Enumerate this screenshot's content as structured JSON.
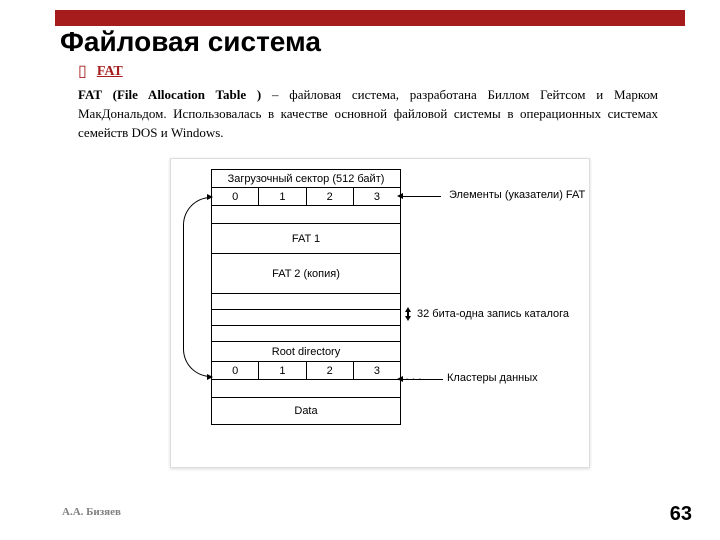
{
  "title": "Файловая система",
  "bullet": "FAT",
  "body_bold": "FAT (File Allocation Table )",
  "body_rest": " – файловая система, разработана Биллом Гейтсом и Марком МакДональдом. Использовалась в качестве основной файловой системы в операционных системах семейств DOS и Windows.",
  "diagram": {
    "boot": "Загрузочный сектор (512 байт)",
    "row_nums": [
      "0",
      "1",
      "2",
      "3"
    ],
    "fat1": "FAT 1",
    "fat2": "FAT 2 (копия)",
    "root": "Root directory",
    "data": "Data",
    "label_elements": "Элементы (указатели) FAT",
    "label_record": "32 бита-одна запись каталога",
    "label_clusters": "Кластеры данных"
  },
  "footer": {
    "author": "А.А. Бизяев",
    "page": "63"
  }
}
